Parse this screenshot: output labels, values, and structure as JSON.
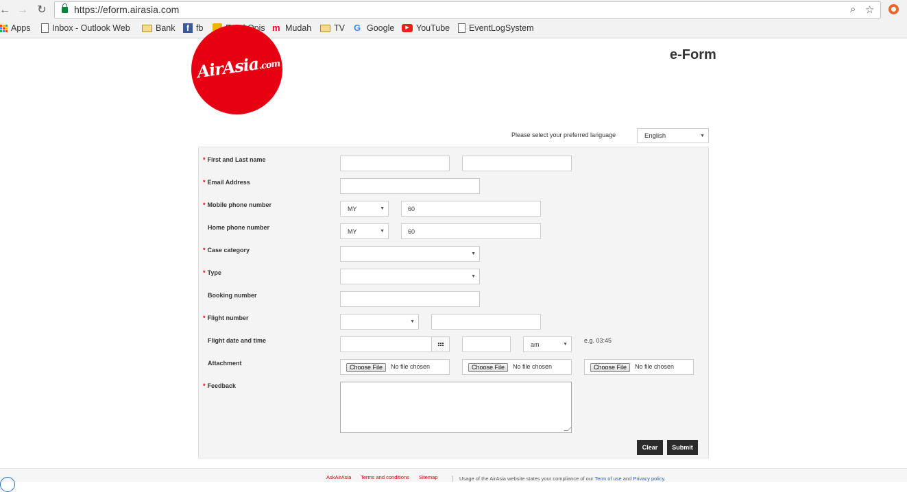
{
  "browser": {
    "url": "https://eform.airasia.com",
    "bookmarks": [
      "Apps",
      "Inbox - Outlook Web",
      "Bank",
      "fb",
      "Emel Opis",
      "Mudah",
      "TV",
      "Google",
      "YouTube",
      "EventLogSystem"
    ]
  },
  "header": {
    "logo_text": "AirAsia",
    "logo_suffix": ".com",
    "title": "e-Form",
    "language_prompt": "Please select your preferred language",
    "language_value": "English"
  },
  "form": {
    "labels": {
      "name": "First and Last name",
      "email": "Email Address",
      "mobile": "Mobile phone number",
      "home": "Home phone number",
      "category": "Case category",
      "type": "Type",
      "booking": "Booking number",
      "flight_number": "Flight number",
      "flight_datetime": "Flight date and time",
      "attachment": "Attachment",
      "feedback": "Feedback"
    },
    "required_marker": "*",
    "mobile_country": "MY",
    "mobile_code": "60",
    "home_country": "MY",
    "home_code": "60",
    "ampm": "am",
    "time_hint": "e.g. 03:45",
    "file_button": "Choose File",
    "file_status": "No file chosen",
    "clear_label": "Clear",
    "submit_label": "Submit"
  },
  "footer": {
    "links": [
      "AskAirAsia",
      "Terms and conditions",
      "Sitemap"
    ],
    "notice_prefix": "Usage of the AirAsia website states your compliance of our ",
    "terms_link": "Term of use",
    "notice_and": " and ",
    "privacy_link": "Privacy policy",
    "notice_end": "."
  },
  "colors": {
    "brand_red": "#e60012",
    "button_dark": "#2b2b2b"
  }
}
